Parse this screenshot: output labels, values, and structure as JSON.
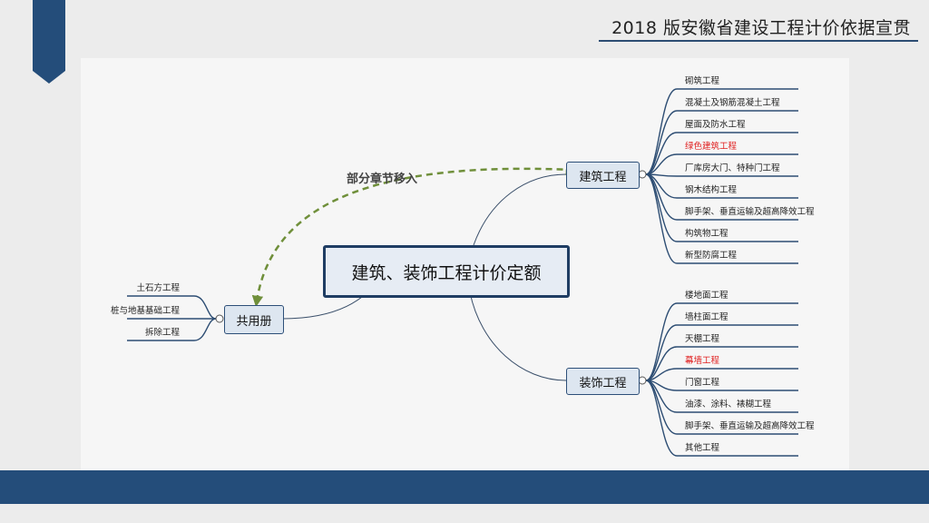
{
  "header": {
    "title": "2018 版安徽省建设工程计价依据宣贯"
  },
  "colors": {
    "accent": "#244d7a",
    "node_fill": "#dde6f0",
    "node_border": "#2d4f78",
    "arrow": "#6f8f3a",
    "highlight": "#e02020"
  },
  "mindmap": {
    "central": "建筑、装饰工程计价定额",
    "annotation": "部分章节移入",
    "common": {
      "label": "共用册",
      "items": [
        "土石方工程",
        "桩与地基基础工程",
        "拆除工程"
      ]
    },
    "building": {
      "label": "建筑工程",
      "items": [
        {
          "text": "砌筑工程",
          "highlight": false
        },
        {
          "text": "混凝土及钢筋混凝土工程",
          "highlight": false
        },
        {
          "text": "屋面及防水工程",
          "highlight": false
        },
        {
          "text": "绿色建筑工程",
          "highlight": true
        },
        {
          "text": "厂库房大门、特种门工程",
          "highlight": false
        },
        {
          "text": "钢木结构工程",
          "highlight": false
        },
        {
          "text": "脚手架、垂直运输及超高降效工程",
          "highlight": false
        },
        {
          "text": "构筑物工程",
          "highlight": false
        },
        {
          "text": "新型防腐工程",
          "highlight": false
        }
      ]
    },
    "decoration": {
      "label": "装饰工程",
      "items": [
        {
          "text": "楼地面工程",
          "highlight": false
        },
        {
          "text": "墙柱面工程",
          "highlight": false
        },
        {
          "text": "天棚工程",
          "highlight": false
        },
        {
          "text": "幕墙工程",
          "highlight": true
        },
        {
          "text": "门窗工程",
          "highlight": false
        },
        {
          "text": "油漆、涂料、裱糊工程",
          "highlight": false
        },
        {
          "text": "脚手架、垂直运输及超高降效工程",
          "highlight": false
        },
        {
          "text": "其他工程",
          "highlight": false
        }
      ]
    }
  }
}
